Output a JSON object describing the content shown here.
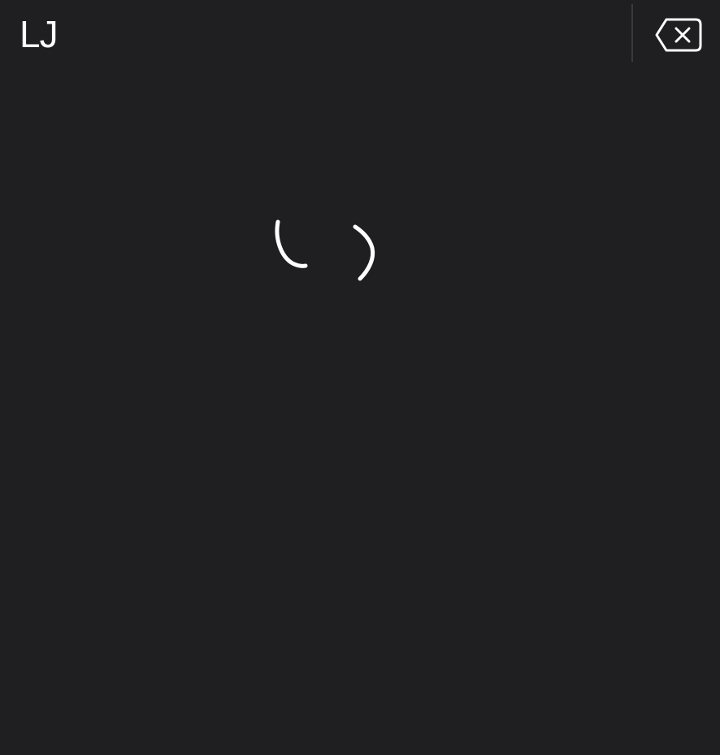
{
  "handwriting_panel": {
    "recognized_text": "LJ",
    "icons": {
      "delete": "delete-backspace-icon"
    },
    "colors": {
      "background": "#1f1e21",
      "ink": "#ffffff",
      "divider": "#3a393d"
    }
  }
}
